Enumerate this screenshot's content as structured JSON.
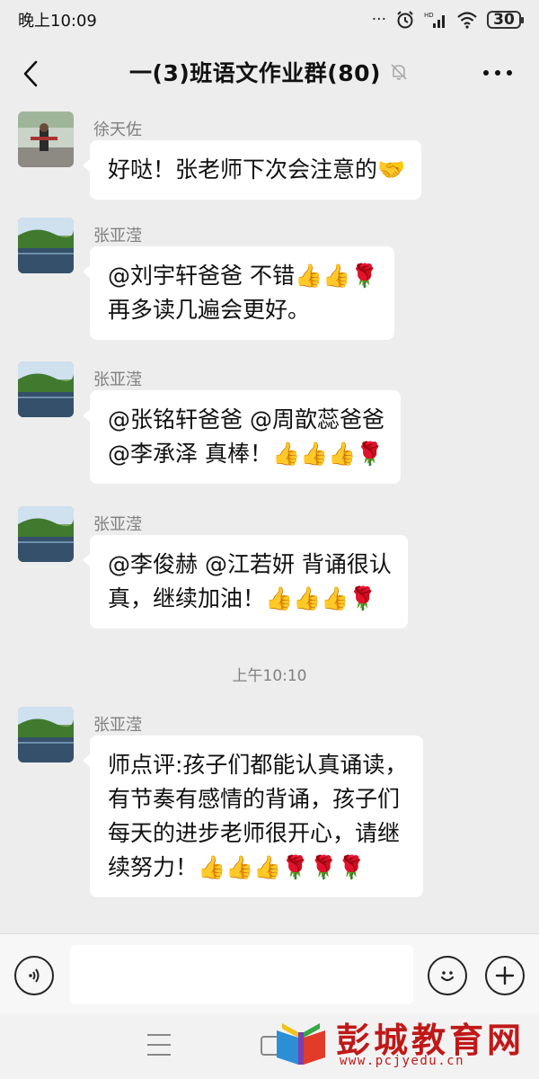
{
  "status_bar": {
    "time": "晚上10:09",
    "battery": "30",
    "hd_label": "HD"
  },
  "nav": {
    "title": "一(3)班语文作业群(80)",
    "back_icon": "chevron-left-icon",
    "mute_icon": "bell-off-icon",
    "more_icon": "more-dots-icon"
  },
  "messages": [
    {
      "sender": "徐天佐",
      "lines": [
        "好哒！张老师下次会注意的🤝"
      ]
    },
    {
      "sender": "张亚滢",
      "lines": [
        "@刘宇轩爸爸  不错👍👍🌹",
        "再多读几遍会更好。"
      ]
    },
    {
      "sender": "张亚滢",
      "lines": [
        "@张铭轩爸爸 @周歆蕊爸爸",
        "@李承泽  真棒！👍👍👍🌹"
      ]
    },
    {
      "sender": "张亚滢",
      "lines": [
        "@李俊赫 @江若妍  背诵很认",
        "真，继续加油！👍👍👍🌹"
      ]
    },
    {
      "sender": "张亚滢",
      "lines": [
        "师点评:孩子们都能认真诵读，",
        "有节奏有感情的背诵，孩子们",
        "每天的进步老师很开心，请继",
        "续努力！👍👍👍🌹🌹🌹"
      ]
    }
  ],
  "timestamp": "上午10:10",
  "input_bar": {
    "voice_icon": "voice-icon",
    "emoji_icon": "smiley-icon",
    "plus_icon": "plus-icon",
    "placeholder": ""
  },
  "watermark": {
    "title": "彭城教育网",
    "url": "www.pcjyedu.cn"
  },
  "colors": {
    "background": "#ededed",
    "bubble": "#ffffff",
    "watermark": "#c01818"
  }
}
